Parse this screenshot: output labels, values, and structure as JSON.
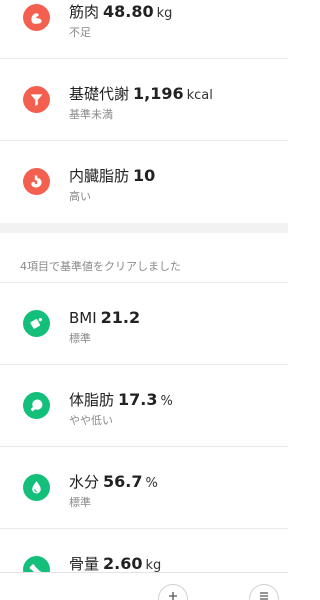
{
  "metrics_top": [
    {
      "name": "筋肉",
      "value": "48.80",
      "unit": "kg",
      "status": "不足",
      "icon": "muscle-icon",
      "color": "#f4604f"
    },
    {
      "name": "基礎代謝",
      "value": "1,196",
      "unit": "kcal",
      "status": "基準未満",
      "icon": "funnel-icon",
      "color": "#f4604f"
    },
    {
      "name": "内臓脂肪",
      "value": "10",
      "unit": "",
      "status": "高い",
      "icon": "stomach-icon",
      "color": "#f4604f"
    }
  ],
  "section": {
    "header": "4項目で基準値をクリアしました"
  },
  "metrics_bottom": [
    {
      "name": "BMI",
      "value": "21.2",
      "unit": "",
      "status": "標準",
      "icon": "bmi-icon",
      "color": "#13bf7a"
    },
    {
      "name": "体脂肪",
      "value": "17.3",
      "unit": "%",
      "status": "やや低い",
      "icon": "body-fat-icon",
      "color": "#13bf7a"
    },
    {
      "name": "水分",
      "value": "56.7",
      "unit": "%",
      "status": "標準",
      "icon": "water-drop-icon",
      "color": "#13bf7a"
    },
    {
      "name": "骨量",
      "value": "2.60",
      "unit": "kg",
      "status": "",
      "icon": "bone-icon",
      "color": "#13bf7a"
    }
  ],
  "bottom_bar": {
    "left_icon": "plus-icon",
    "right_icon": "menu-icon"
  }
}
